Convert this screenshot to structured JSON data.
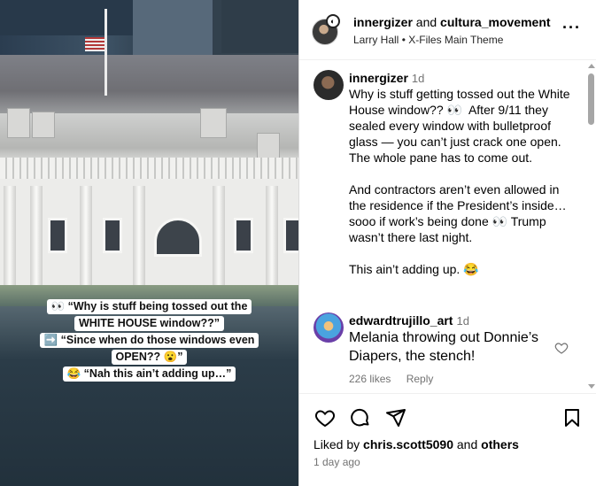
{
  "media": {
    "captions": [
      "👀 “Why is stuff being tossed out the",
      "WHITE HOUSE window??”",
      "➡️ “Since when do those windows even",
      "OPEN?? 😮”",
      "😂 “Nah this ain’t adding up…”"
    ]
  },
  "header": {
    "user1": "innergizer",
    "and": "and",
    "user2": "cultura_movement",
    "audio_artist": "Larry Hall",
    "audio_sep": "•",
    "audio_track": "X-Files Main Theme",
    "more_icon": "more-options-icon"
  },
  "comments": [
    {
      "username": "innergizer",
      "time": "1d",
      "text": "Why is stuff getting tossed out the White House window?? 👀  After 9/11 they sealed every window with bulletproof glass — you can’t just crack one open. The whole pane has to come out.\n\nAnd contractors aren’t even allowed in the residence if the President’s inside… sooo if work’s being done 👀 Trump wasn’t there last night.\n\nThis ain’t adding up. 😂"
    },
    {
      "username": "edwardtrujillo_art",
      "time": "1d",
      "text": "Melania throwing out Donnie’s Diapers, the stench!",
      "likes": "226 likes",
      "reply": "Reply"
    }
  ],
  "actions": {
    "icons": [
      "heart-icon",
      "comment-icon",
      "share-icon",
      "save-icon"
    ],
    "liked_by_prefix": "Liked by",
    "liked_by_user": "chris.scott5090",
    "liked_by_and": "and",
    "liked_by_others": "others",
    "date": "1 day ago"
  }
}
